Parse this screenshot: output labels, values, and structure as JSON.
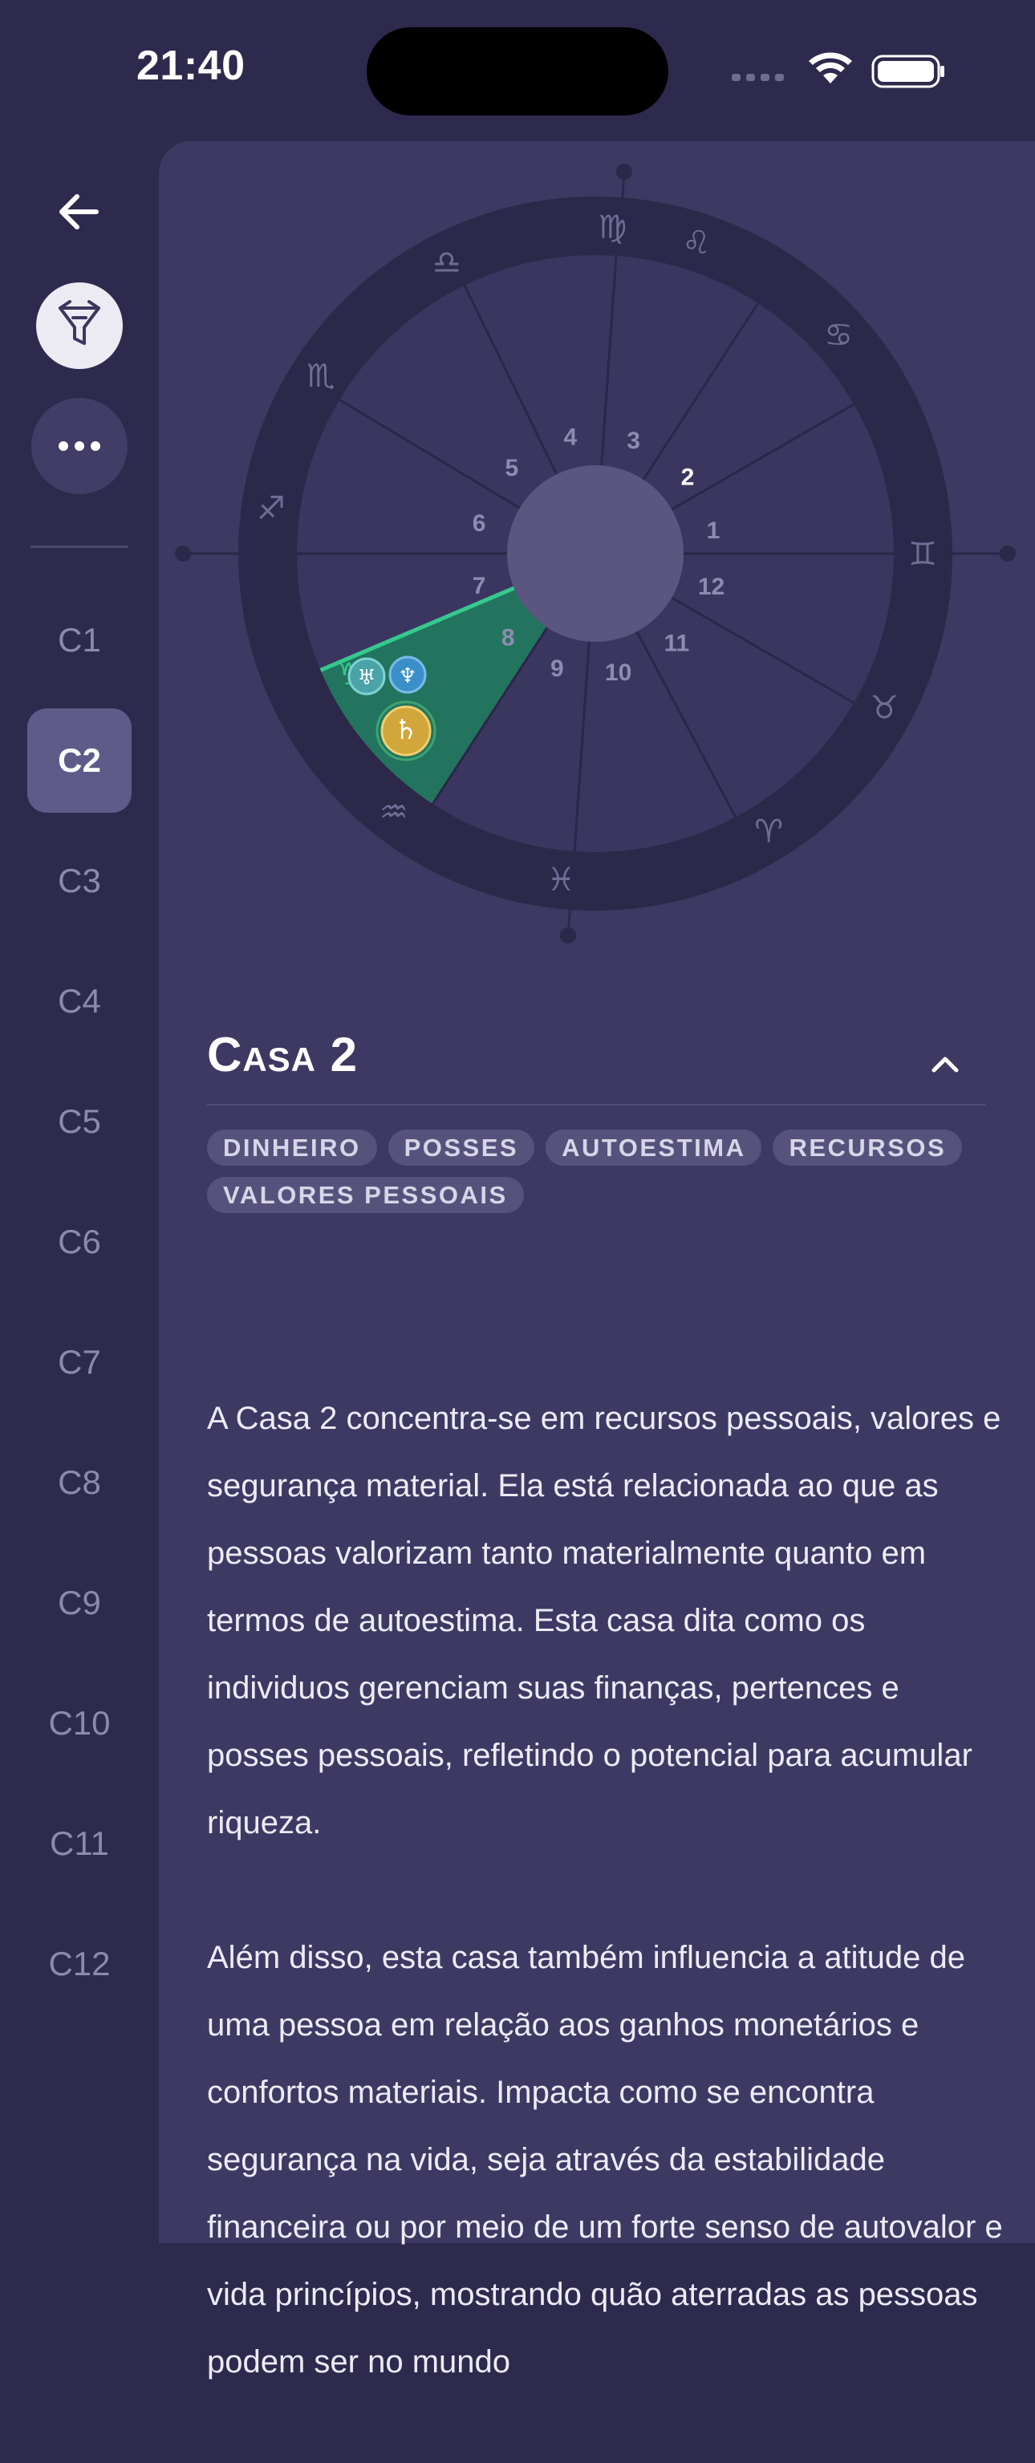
{
  "status_bar": {
    "time": "21:40"
  },
  "sidebar": {
    "houses": [
      "C1",
      "C2",
      "C3",
      "C4",
      "C5",
      "C6",
      "C7",
      "C8",
      "C9",
      "C10",
      "C11",
      "C12"
    ],
    "active": "C2"
  },
  "chart": {
    "signs": [
      "Leo",
      "Cancer",
      "Gemini",
      "Taurus",
      "Aries",
      "Pisces",
      "Aquarius",
      "Capricorn",
      "Sagittarius",
      "Scorpio",
      "Libra",
      "Virgo"
    ],
    "house_numbers": [
      "1",
      "2",
      "3",
      "4",
      "5",
      "6",
      "7",
      "8",
      "9",
      "10",
      "11",
      "12"
    ],
    "highlighted_house": "2",
    "highlighted_sign": "Capricorn",
    "planets_in_house": [
      "Uranus",
      "Neptune",
      "Saturn"
    ],
    "colors": {
      "highlight": "#23745f",
      "highlight_line": "#35c98e",
      "ring": "#2b2849",
      "inner": "#3a3660",
      "hub": "#5a5680"
    }
  },
  "section": {
    "title": "Casa 2",
    "tags": [
      "DINHEIRO",
      "POSSES",
      "AUTOESTIMA",
      "RECURSOS",
      "VALORES PESSOAIS"
    ],
    "paragraphs": [
      "A Casa 2 concentra-se em recursos pessoais, valores e segurança material. Ela está relacionada ao que as pessoas valorizam tanto materialmente quanto em termos de autoestima. Esta casa dita como os individuos gerenciam suas finanças, pertences e posses pessoais, refletindo o potencial para acumular riqueza.",
      "Além disso, esta casa também influencia a atitude de uma pessoa em relação aos ganhos monetários e confortos materiais. Impacta como se encontra segurança na vida, seja através da estabilidade financeira ou por meio de um forte senso de autovalor e vida princípios, mostrando quão aterradas as pessoas podem ser no mundo"
    ]
  }
}
